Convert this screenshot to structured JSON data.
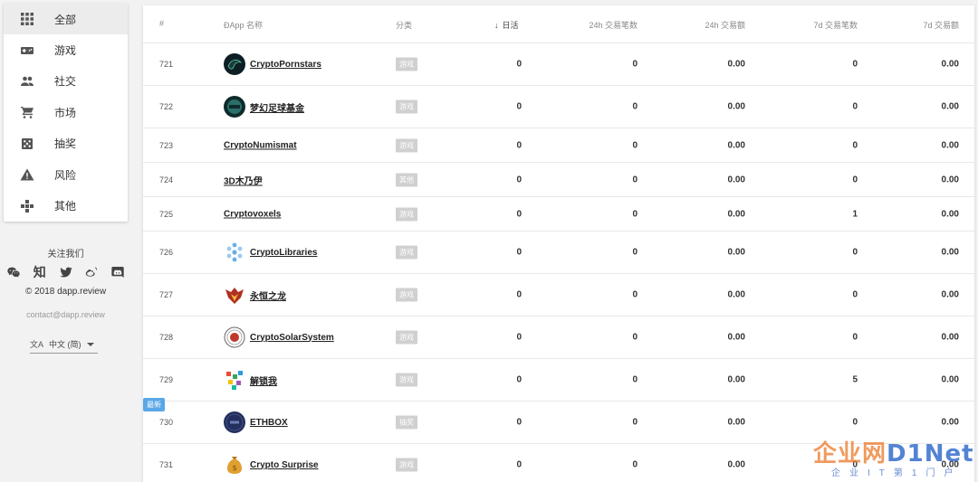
{
  "sidebar": {
    "items": [
      {
        "label": "全部",
        "icon": "grid-icon",
        "active": true
      },
      {
        "label": "游戏",
        "icon": "gamepad-icon",
        "active": false
      },
      {
        "label": "社交",
        "icon": "people-icon",
        "active": false
      },
      {
        "label": "市场",
        "icon": "cart-icon",
        "active": false
      },
      {
        "label": "抽奖",
        "icon": "dice-icon",
        "active": false
      },
      {
        "label": "风险",
        "icon": "warning-icon",
        "active": false
      },
      {
        "label": "其他",
        "icon": "puzzle-icon",
        "active": false
      }
    ]
  },
  "footer": {
    "follow": "关注我们",
    "zhihu": "知",
    "copyright": "© 2018 dapp.review",
    "contact": "contact@dapp.review",
    "language": "中文 (简)",
    "language_icon": "文A"
  },
  "table": {
    "headers": {
      "num": "#",
      "name": "ĐApp 名称",
      "category": "分类",
      "daily_active": "日活",
      "tx_24h": "24h 交易笔数",
      "vol_24h": "24h 交易额",
      "tx_7d": "7d 交易笔数",
      "vol_7d": "7d 交易额"
    },
    "sort_arrow": "↓",
    "new_badge": "最新",
    "rows": [
      {
        "num": "721",
        "name": "CryptoPornstars",
        "category": "游戏",
        "dau": "0",
        "tx24": "0",
        "vol24": "0.00",
        "tx7": "0",
        "vol7": "0.00",
        "logo": "dark-swirl",
        "logo_color": "#1d3a3a"
      },
      {
        "num": "722",
        "name": "梦幻足球基金",
        "category": "游戏",
        "dau": "0",
        "tx24": "0",
        "vol24": "0.00",
        "tx7": "0",
        "vol7": "0.00",
        "logo": "teal-circle",
        "logo_color": "#2a6f6a"
      },
      {
        "num": "723",
        "name": "CryptoNumismat",
        "category": "游戏",
        "dau": "0",
        "tx24": "0",
        "vol24": "0.00",
        "tx7": "0",
        "vol7": "0.00",
        "logo": "",
        "logo_color": ""
      },
      {
        "num": "724",
        "name": "3D木乃伊",
        "category": "其他",
        "dau": "0",
        "tx24": "0",
        "vol24": "0.00",
        "tx7": "0",
        "vol7": "0.00",
        "logo": "",
        "logo_color": ""
      },
      {
        "num": "725",
        "name": "Cryptovoxels",
        "category": "游戏",
        "dau": "0",
        "tx24": "0",
        "vol24": "0.00",
        "tx7": "1",
        "vol7": "0.00",
        "logo": "",
        "logo_color": ""
      },
      {
        "num": "726",
        "name": "CryptoLibraries",
        "category": "游戏",
        "dau": "0",
        "tx24": "0",
        "vol24": "0.00",
        "tx7": "0",
        "vol7": "0.00",
        "logo": "blue-dots",
        "logo_color": "#6aaee8"
      },
      {
        "num": "727",
        "name": "永恒之龙",
        "category": "游戏",
        "dau": "0",
        "tx24": "0",
        "vol24": "0.00",
        "tx7": "0",
        "vol7": "0.00",
        "logo": "red-dragon",
        "logo_color": "#b03020"
      },
      {
        "num": "728",
        "name": "CryptoSolarSystem",
        "category": "游戏",
        "dau": "0",
        "tx24": "0",
        "vol24": "0.00",
        "tx7": "0",
        "vol7": "0.00",
        "logo": "solar-ring",
        "logo_color": "#c0392b"
      },
      {
        "num": "729",
        "name": "解锁我",
        "category": "游戏",
        "dau": "0",
        "tx24": "0",
        "vol24": "0.00",
        "tx7": "5",
        "vol7": "0.00",
        "logo": "pixel-blocks",
        "logo_color": "#3aa060"
      },
      {
        "num": "730",
        "name": "ETHBOX",
        "category": "抽奖",
        "dau": "0",
        "tx24": "0",
        "vol24": "0.00",
        "tx7": "0",
        "vol7": "0.00",
        "logo": "navy-box",
        "logo_color": "#23305e",
        "is_new": true
      },
      {
        "num": "731",
        "name": "Crypto Surprise",
        "category": "游戏",
        "dau": "0",
        "tx24": "0",
        "vol24": "0.00",
        "tx7": "0",
        "vol7": "0.00",
        "logo": "money-bag",
        "logo_color": "#e0a030"
      }
    ]
  },
  "watermark": {
    "brand": "企业网",
    "brand_suffix": "D1Net",
    "tagline": "企业IT第1门户"
  },
  "colors": {
    "new_badge": "#5aa7e8",
    "category_badge": "#d0d0d0",
    "active_nav": "#ececec"
  }
}
